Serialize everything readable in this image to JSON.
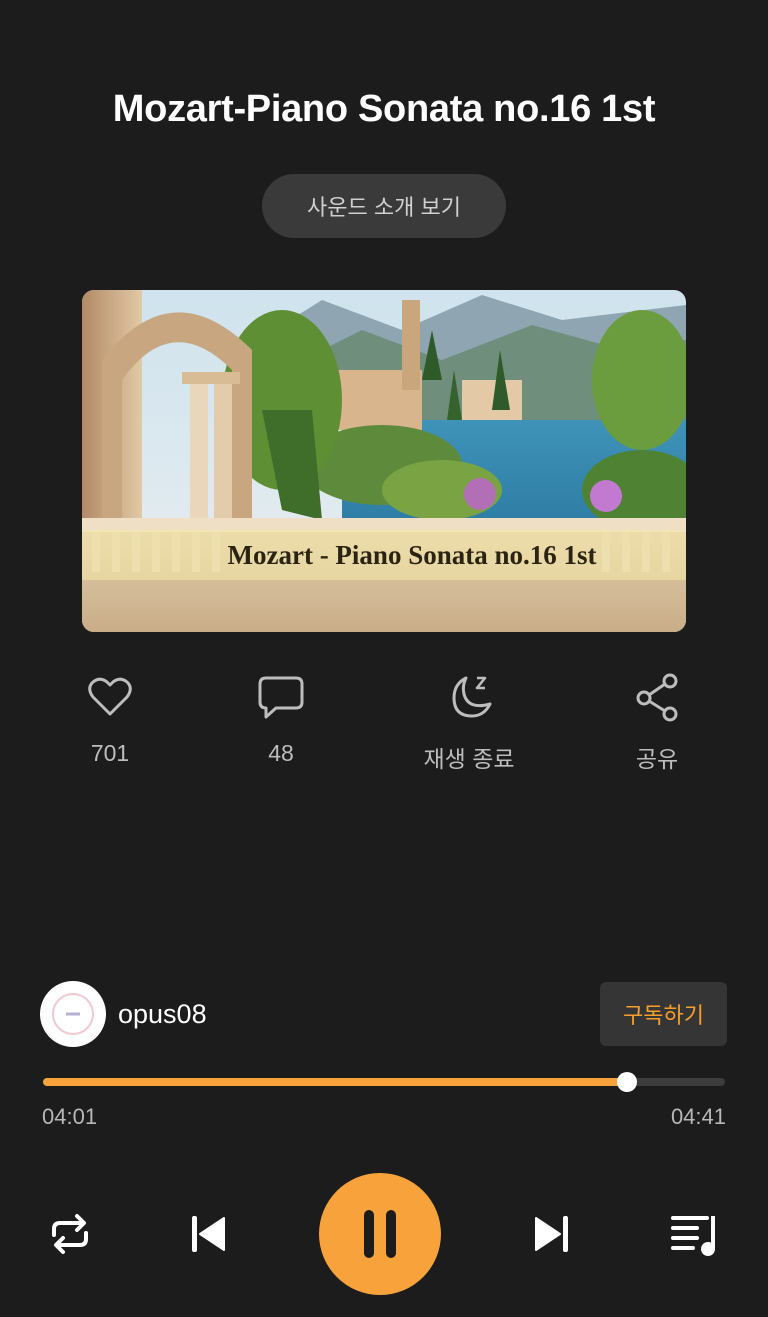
{
  "track": {
    "title": "Mozart-Piano Sonata no.16 1st",
    "intro_button": "사운드 소개 보기",
    "cover_caption": "Mozart - Piano Sonata no.16 1st"
  },
  "actions": [
    {
      "icon": "heart-icon",
      "label": "701"
    },
    {
      "icon": "comment-icon",
      "label": "48"
    },
    {
      "icon": "sleep-timer-icon",
      "label": "재생 종료"
    },
    {
      "icon": "share-icon",
      "label": "공유"
    }
  ],
  "creator": {
    "name": "opus08",
    "subscribe_label": "구독하기"
  },
  "player": {
    "elapsed": "04:01",
    "duration": "04:41",
    "progress_fraction": 0.857,
    "controls": [
      "repeat-icon",
      "previous-icon",
      "pause-icon",
      "next-icon",
      "playlist-icon"
    ]
  },
  "colors": {
    "background": "#1c1c1c",
    "accent": "#f7a23b",
    "muted_text": "#bdbdbd",
    "button_bg": "#3a3a3a"
  }
}
